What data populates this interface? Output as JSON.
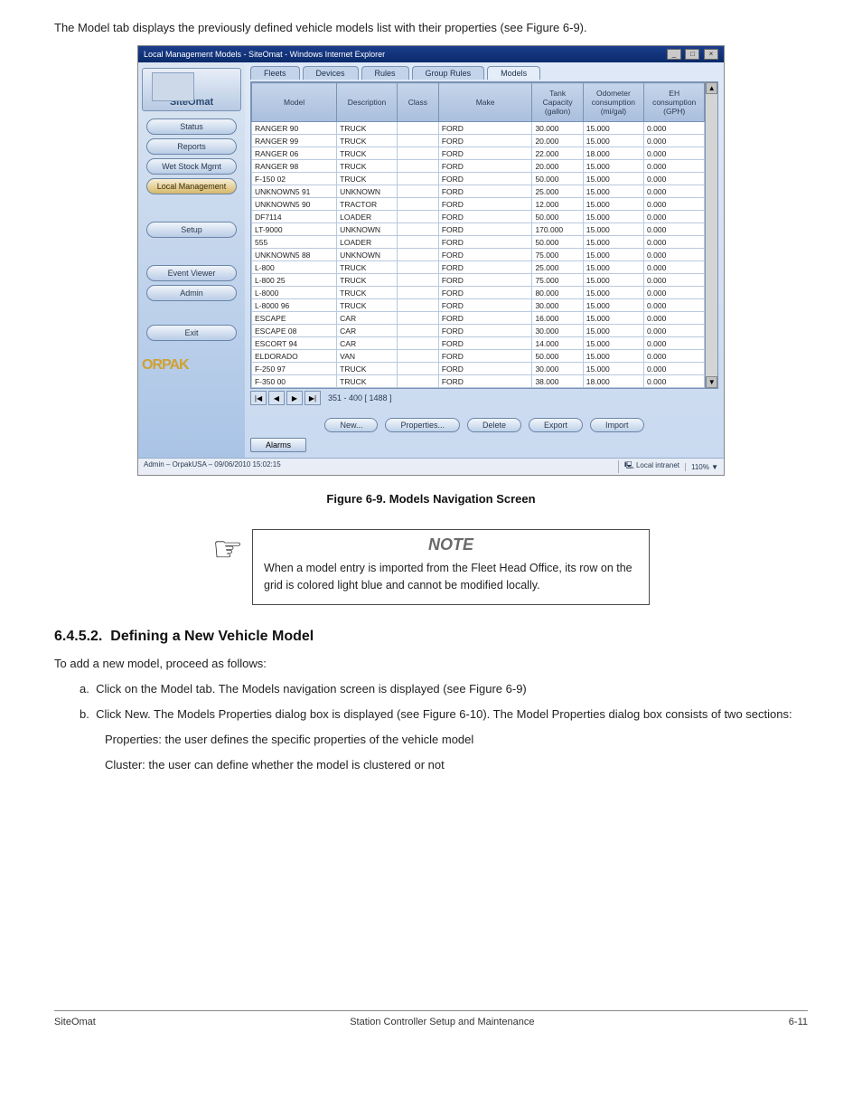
{
  "intro_text": "The Model tab displays the previously defined vehicle models list with their properties (see Figure 6-9).",
  "window": {
    "title": "Local Management Models - SiteOmat - Windows Internet Explorer",
    "logo_text": "SiteOmat",
    "brand_bottom": "ORPAK",
    "status_left": "Admin – OrpakUSA – 09/06/2010  15:02:15",
    "status_zone_text": "Local intranet",
    "status_zoom": "110%  ▼",
    "nav": [
      {
        "label": "Status",
        "active": false
      },
      {
        "label": "Reports",
        "active": false
      },
      {
        "label": "Wet Stock Mgmt",
        "active": false
      },
      {
        "label": "Local Management",
        "active": true
      },
      {
        "label": "Setup",
        "active": false
      },
      {
        "label": "Event Viewer",
        "active": false
      },
      {
        "label": "Admin",
        "active": false
      },
      {
        "label": "Exit",
        "active": false
      }
    ],
    "nav_gaps": {
      "after_index_3": true,
      "after_index_4": true,
      "after_index_6": true
    },
    "tabs": [
      "Fleets",
      "Devices",
      "Rules",
      "Group Rules",
      "Models"
    ],
    "active_tab": "Models",
    "columns": [
      "Model",
      "Description",
      "Class",
      "Make",
      "Tank Capacity (gallon)",
      "Odometer consumption (mi/gal)",
      "EH consumption (GPH)"
    ],
    "rows": [
      [
        "RANGER 90",
        "TRUCK",
        "",
        "FORD",
        "30.000",
        "15.000",
        "0.000"
      ],
      [
        "RANGER 99",
        "TRUCK",
        "",
        "FORD",
        "20.000",
        "15.000",
        "0.000"
      ],
      [
        "RANGER 06",
        "TRUCK",
        "",
        "FORD",
        "22.000",
        "18.000",
        "0.000"
      ],
      [
        "RANGER 98",
        "TRUCK",
        "",
        "FORD",
        "20.000",
        "15.000",
        "0.000"
      ],
      [
        "F-150 02",
        "TRUCK",
        "",
        "FORD",
        "50.000",
        "15.000",
        "0.000"
      ],
      [
        "UNKNOWN5 91",
        "UNKNOWN",
        "",
        "FORD",
        "25.000",
        "15.000",
        "0.000"
      ],
      [
        "UNKNOWN5 90",
        "TRACTOR",
        "",
        "FORD",
        "12.000",
        "15.000",
        "0.000"
      ],
      [
        "DF7114",
        "LOADER",
        "",
        "FORD",
        "50.000",
        "15.000",
        "0.000"
      ],
      [
        "LT-9000",
        "UNKNOWN",
        "",
        "FORD",
        "170.000",
        "15.000",
        "0.000"
      ],
      [
        "555",
        "LOADER",
        "",
        "FORD",
        "50.000",
        "15.000",
        "0.000"
      ],
      [
        "UNKNOWN5 88",
        "UNKNOWN",
        "",
        "FORD",
        "75.000",
        "15.000",
        "0.000"
      ],
      [
        "L-800",
        "TRUCK",
        "",
        "FORD",
        "25.000",
        "15.000",
        "0.000"
      ],
      [
        "L-800 25",
        "TRUCK",
        "",
        "FORD",
        "75.000",
        "15.000",
        "0.000"
      ],
      [
        "L-8000",
        "TRUCK",
        "",
        "FORD",
        "80.000",
        "15.000",
        "0.000"
      ],
      [
        "L-8000 96",
        "TRUCK",
        "",
        "FORD",
        "30.000",
        "15.000",
        "0.000"
      ],
      [
        "ESCAPE",
        "CAR",
        "",
        "FORD",
        "16.000",
        "15.000",
        "0.000"
      ],
      [
        "ESCAPE 08",
        "CAR",
        "",
        "FORD",
        "30.000",
        "15.000",
        "0.000"
      ],
      [
        "ESCORT 94",
        "CAR",
        "",
        "FORD",
        "14.000",
        "15.000",
        "0.000"
      ],
      [
        "ELDORADO",
        "VAN",
        "",
        "FORD",
        "50.000",
        "15.000",
        "0.000"
      ],
      [
        "F-250 97",
        "TRUCK",
        "",
        "FORD",
        "30.000",
        "15.000",
        "0.000"
      ],
      [
        "F-350 00",
        "TRUCK",
        "",
        "FORD",
        "38.000",
        "18.000",
        "0.000"
      ]
    ],
    "pager_info": "351 - 400  [ 1488 ]",
    "pager_first": "|◀",
    "pager_prev": "◀",
    "pager_next": "▶",
    "pager_last": "▶|",
    "actions": [
      "New...",
      "Properties...",
      "Delete",
      "Export",
      "Import"
    ],
    "alarms_label": "Alarms"
  },
  "figure_caption": "Figure 6-9. Models Navigation Screen",
  "note": {
    "heading": "NOTE",
    "body": "When a model entry is imported from the Fleet Head Office, its row on the grid is colored light blue and cannot be modified locally."
  },
  "section": {
    "number": "6.4.5.2.",
    "title": "Defining a New Vehicle Model",
    "p1": "To add a new model, proceed as follows:",
    "list_a": "Click on the Model tab. The Models navigation screen is displayed (see Figure 6-9)",
    "list_b_1": "Click New. The Models Properties dialog box is displayed (see Figure 6-10). The Model Properties dialog box consists of two sections:",
    "list_b_2": "Properties: the user defines the specific properties of the vehicle model",
    "list_b_3": "Cluster: the user can define whether the model is clustered or not",
    "list_a_prefix": "a.",
    "list_b_prefix": "b."
  },
  "footer": {
    "left": "SiteOmat",
    "center": "Station Controller Setup and Maintenance",
    "right": "6-11"
  }
}
